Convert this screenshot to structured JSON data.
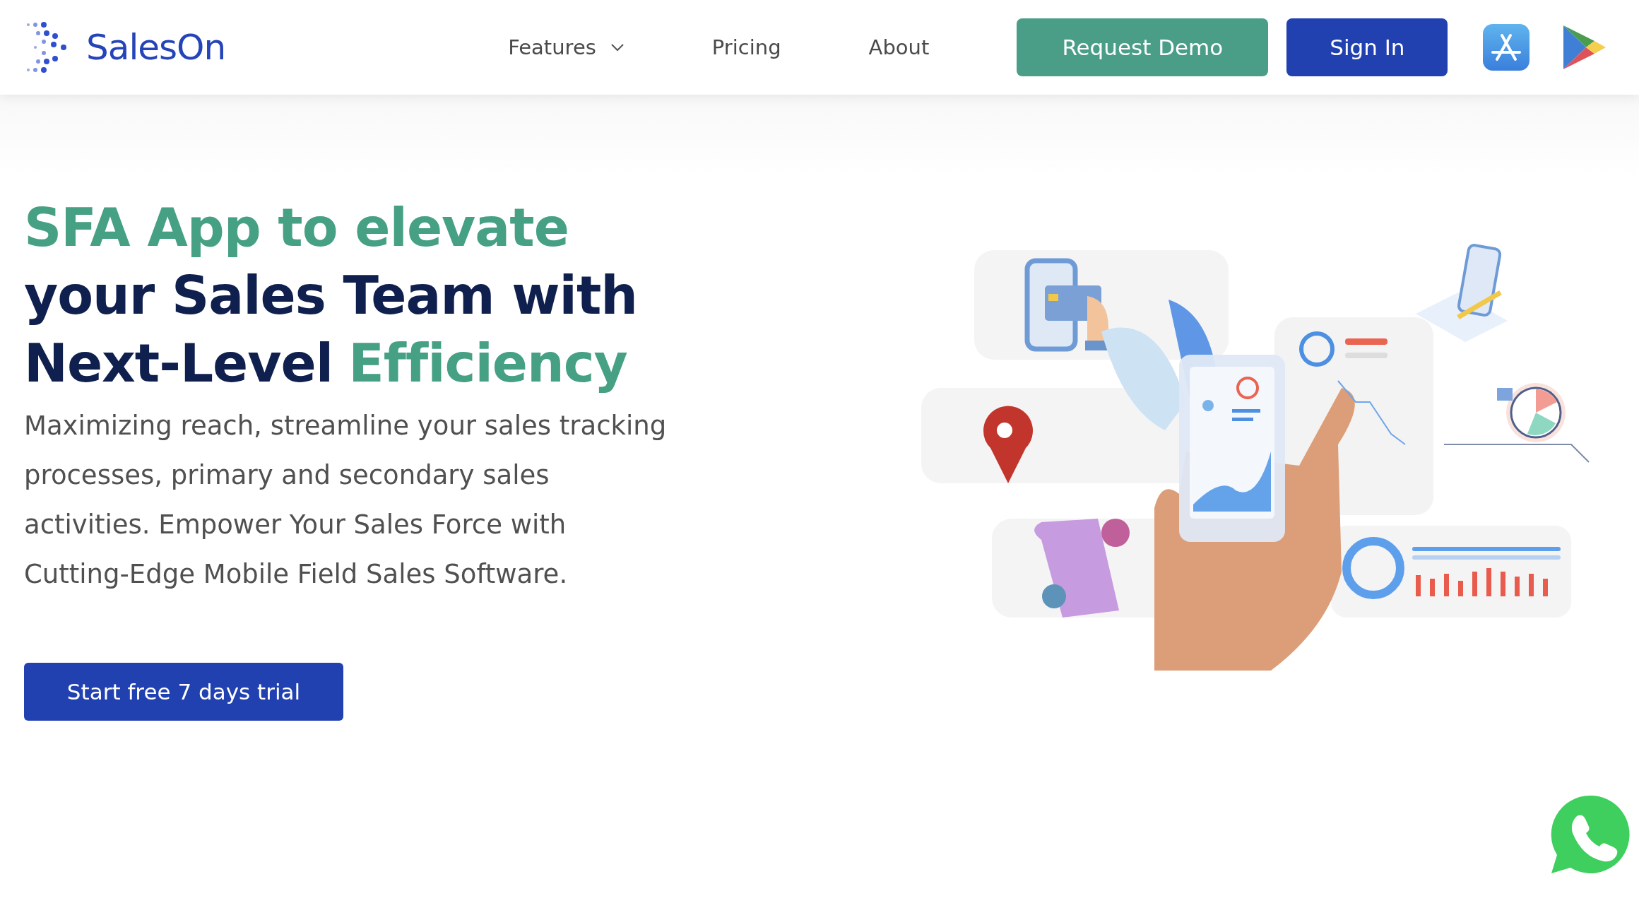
{
  "header": {
    "logo": "SalesOn",
    "nav": [
      {
        "label": "Features",
        "dropdown": true
      },
      {
        "label": "Pricing",
        "dropdown": false
      },
      {
        "label": "About",
        "dropdown": false
      }
    ],
    "buttons": [
      {
        "label": "Request Demo",
        "kind": "secondary"
      },
      {
        "label": "Sign In",
        "kind": "primary"
      }
    ]
  },
  "hero": {
    "headline": [
      [
        {
          "text": "SFA App to elevate",
          "accent": true
        }
      ],
      [
        {
          "text": "your Sales Team with",
          "accent": false
        }
      ],
      [
        {
          "text": "Next-Level",
          "accent": false
        },
        {
          "text": "Efficiency",
          "accent": true
        }
      ]
    ],
    "description": "Maximizing reach, streamline your sales tracking processes, primary and secondary sales activities. Empower Your Sales Force with Cutting-Edge Mobile Field Sales Software.",
    "cta": "Start free 7 days trial"
  }
}
